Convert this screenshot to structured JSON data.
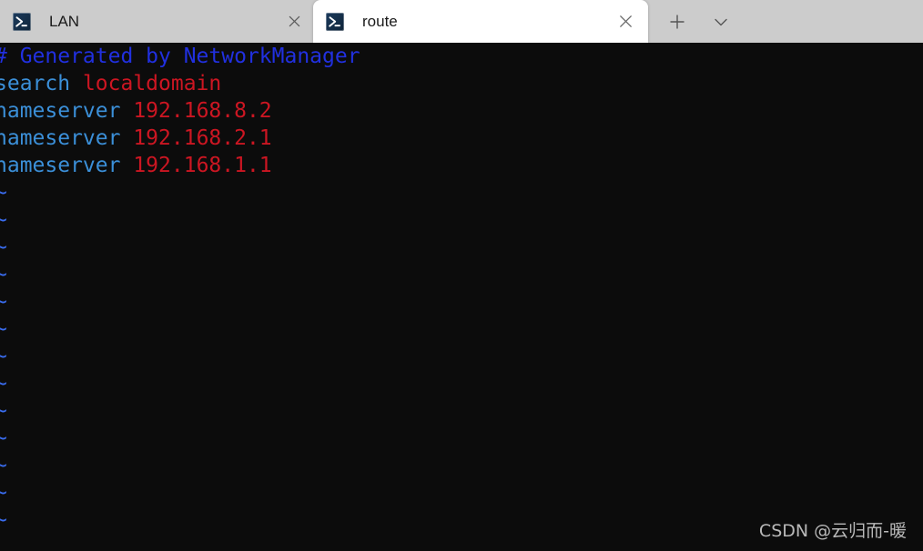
{
  "window": {
    "app": "Windows Terminal",
    "titlebar_color": "#cccccc",
    "terminal_background": "#0c0c0c"
  },
  "tabs": [
    {
      "label": "LAN",
      "state": "inactive",
      "icon": "powershell-icon",
      "close_label": "×"
    },
    {
      "label": "route",
      "state": "active",
      "icon": "powershell-icon",
      "close_label": "×"
    }
  ],
  "tabbar_buttons": {
    "new_tab_label": "+",
    "dropdown_label": "⌄"
  },
  "terminal": {
    "colors": {
      "comment": "#2130e0",
      "keyword": "#3b8fd8",
      "value": "#cc1622",
      "tilde": "#3a6df0",
      "background": "#0c0c0c"
    },
    "lines": [
      {
        "type": "comment",
        "text": "# Generated by NetworkManager"
      },
      {
        "type": "directive",
        "keyword": "search",
        "value": "localdomain"
      },
      {
        "type": "directive",
        "keyword": "nameserver",
        "value": "192.168.8.2"
      },
      {
        "type": "directive",
        "keyword": "nameserver",
        "value": "192.168.2.1"
      },
      {
        "type": "directive",
        "keyword": "nameserver",
        "value": "192.168.1.1"
      }
    ],
    "empty_line_marker": "~",
    "empty_line_count": 13
  },
  "watermark": {
    "text": "CSDN @云归而-暖"
  }
}
